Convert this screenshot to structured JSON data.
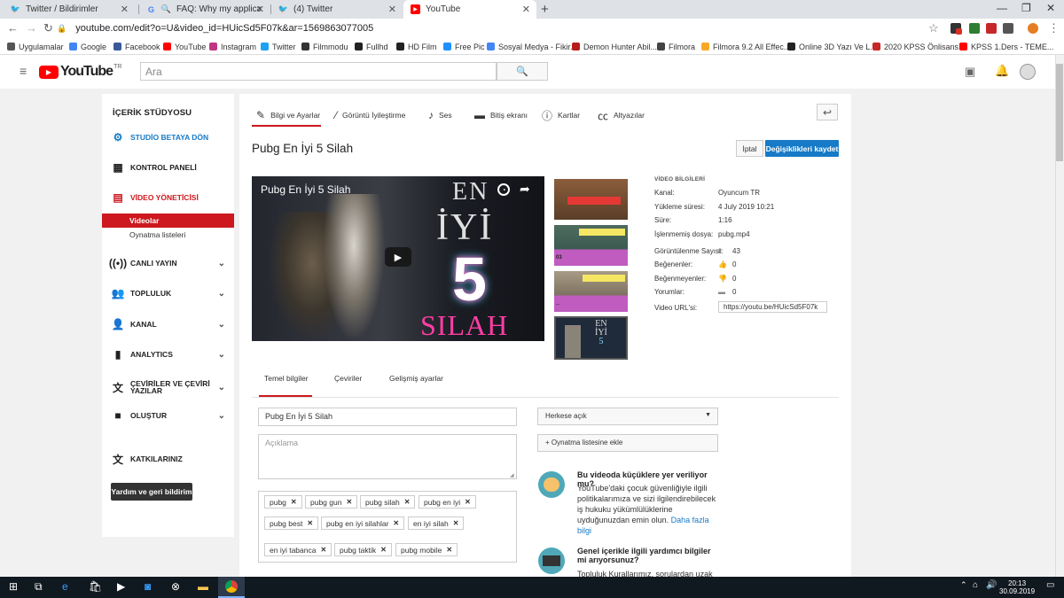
{
  "browser": {
    "tabs": [
      {
        "title": "Twitter / Bildirimler"
      },
      {
        "title": "FAQ: Why my application for"
      },
      {
        "title": "(4) Twitter"
      },
      {
        "title": "YouTube"
      }
    ],
    "url": "youtube.com/edit?o=U&video_id=HUicSd5F07k&ar=1569863077005"
  },
  "bookmarks": [
    {
      "label": "Uygulamalar",
      "color": "#555"
    },
    {
      "label": "Google",
      "color": "#4285f4"
    },
    {
      "label": "Facebook",
      "color": "#3b5998"
    },
    {
      "label": "YouTube",
      "color": "#ff0000"
    },
    {
      "label": "Instagram",
      "color": "#c13584"
    },
    {
      "label": "Twitter",
      "color": "#1da1f2"
    },
    {
      "label": "Filmmodu",
      "color": "#333"
    },
    {
      "label": "Fullhd",
      "color": "#222"
    },
    {
      "label": "HD Film",
      "color": "#222"
    },
    {
      "label": "Free Pic",
      "color": "#1e90ff"
    },
    {
      "label": "Sosyal Medya - Fikir...",
      "color": "#4285f4"
    },
    {
      "label": "Demon Hunter Abil...",
      "color": "#b71c1c"
    },
    {
      "label": "Filmora",
      "color": "#444"
    },
    {
      "label": "Filmora 9.2 All Effec...",
      "color": "#f9a825"
    },
    {
      "label": "Online 3D Yazı Ve L...",
      "color": "#222"
    },
    {
      "label": "2020 KPSS Önlisans...",
      "color": "#c62828"
    },
    {
      "label": "KPSS 1.Ders - TEME...",
      "color": "#ff0000"
    }
  ],
  "youtube": {
    "logo_text": "YouTube",
    "region": "TR",
    "search_placeholder": "Ara"
  },
  "sidebar": {
    "heading": "İÇERİK STÜDYOSU",
    "items": [
      {
        "label": "STUDİO BETAYA DÖN",
        "icon": "gear-icon"
      },
      {
        "label": "KONTROL PANELİ",
        "icon": "dashboard-icon"
      },
      {
        "label": "VİDEO YÖNETİCİSİ",
        "icon": "video-manager-icon"
      },
      {
        "label": "CANLI YAYIN",
        "icon": "live-icon"
      },
      {
        "label": "TOPLULUK",
        "icon": "community-icon"
      },
      {
        "label": "KANAL",
        "icon": "channel-icon"
      },
      {
        "label": "ANALYTICS",
        "icon": "analytics-icon"
      },
      {
        "label": "ÇEVİRİLER VE ÇEVİRİ YAZILAR",
        "icon": "translate-icon"
      },
      {
        "label": "OLUŞTUR",
        "icon": "create-icon"
      },
      {
        "label": "KATKILARINIZ",
        "icon": "contributions-icon"
      }
    ],
    "subitems": [
      "Videolar",
      "Oynatma listeleri"
    ],
    "help_button": "Yardım ve geri bildirim"
  },
  "editor": {
    "tabs": [
      "Bilgi ve Ayarlar",
      "Görüntü İyileştirme",
      "Ses",
      "Bitiş ekranı",
      "Kartlar",
      "Altyazılar"
    ],
    "video_title": "Pubg En İyi 5 Silah",
    "cancel_label": "İptal",
    "save_label": "Değişiklikleri kaydet",
    "player": {
      "title": "Pubg En İyi 5 Silah",
      "art_en": "EN",
      "art_iyi": "İYİ",
      "art_5": "5",
      "art_silah": "SILAH"
    },
    "thumbnails": [
      "thumb-1",
      "thumb-2",
      "thumb-3",
      "thumb-4"
    ],
    "thumb_badges": [
      "03",
      "--"
    ]
  },
  "video_info": {
    "heading": "VİDEO BİLGİLERİ",
    "rows": [
      {
        "label": "Kanal:",
        "value": "Oyuncum TR"
      },
      {
        "label": "Yükleme süresi:",
        "value": "4 July 2019 10:21"
      },
      {
        "label": "Süre:",
        "value": "1:16"
      },
      {
        "label": "İşlenmemiş dosya:",
        "value": "pubg.mp4"
      },
      {
        "label": "Görüntülenme Sayısı:",
        "value": "43"
      },
      {
        "label": "Beğenenler:",
        "value": "0"
      },
      {
        "label": "Beğenmeyenler:",
        "value": "0"
      },
      {
        "label": "Yorumlar:",
        "value": "0"
      },
      {
        "label": "Video URL'si:",
        "value": "https://youtu.be/HUicSd5F07k"
      }
    ]
  },
  "subtabs": [
    "Temel bilgiler",
    "Çeviriler",
    "Gelişmiş ayarlar"
  ],
  "form": {
    "title_value": "Pubg En İyi 5 Silah",
    "description_placeholder": "Açıklama",
    "privacy_value": "Herkese açık",
    "playlist_button": "+ Oynatma listesine ekle",
    "tags": [
      "pubg",
      "pubg gun",
      "pubg silah",
      "pubg en iyi",
      "pubg best",
      "pubg en iyi silahlar",
      "en iyi silah",
      "en iyi tabanca",
      "pubg taktik",
      "pubg mobile"
    ]
  },
  "tips": [
    {
      "heading": "Bu videoda küçüklere yer veriliyor mu?",
      "text": "YouTube'daki çocuk güvenliğiyle ilgili politikalarımıza ve sizi ilgilendirebilecek iş hukuku yükümlülüklerine uyduğunuzdan emin olun.",
      "link": "Daha fazla bilgi"
    },
    {
      "heading": "Genel içerikle ilgili yardımcı bilgiler mi arıyorsunuz?",
      "text": "Topluluk Kurallarımız, sorulardan uzak"
    }
  ],
  "taskbar": {
    "time": "20:13",
    "date": "30.09.2019"
  }
}
